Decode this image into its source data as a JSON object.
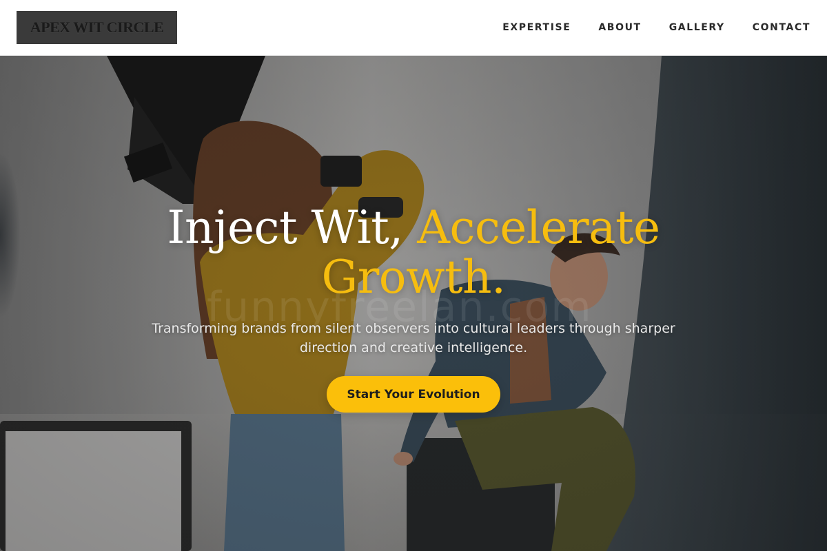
{
  "header": {
    "logo_text": "APEX WIT CIRCLE",
    "nav": [
      {
        "label": "EXPERTISE"
      },
      {
        "label": "ABOUT"
      },
      {
        "label": "GALLERY"
      },
      {
        "label": "CONTACT"
      }
    ]
  },
  "hero": {
    "headline_part1": "Inject Wit, ",
    "headline_part2": "Accelerate Growth.",
    "subtext": "Transforming brands from silent observers into cultural leaders through sharper direction and creative intelligence.",
    "cta_label": "Start Your Evolution",
    "watermark": "funnyfreelan.com"
  },
  "colors": {
    "accent": "#f6bd0f",
    "cta_background": "#fbbf0a",
    "header_background": "#ffffff",
    "logo_background": "#3a3a3a"
  }
}
